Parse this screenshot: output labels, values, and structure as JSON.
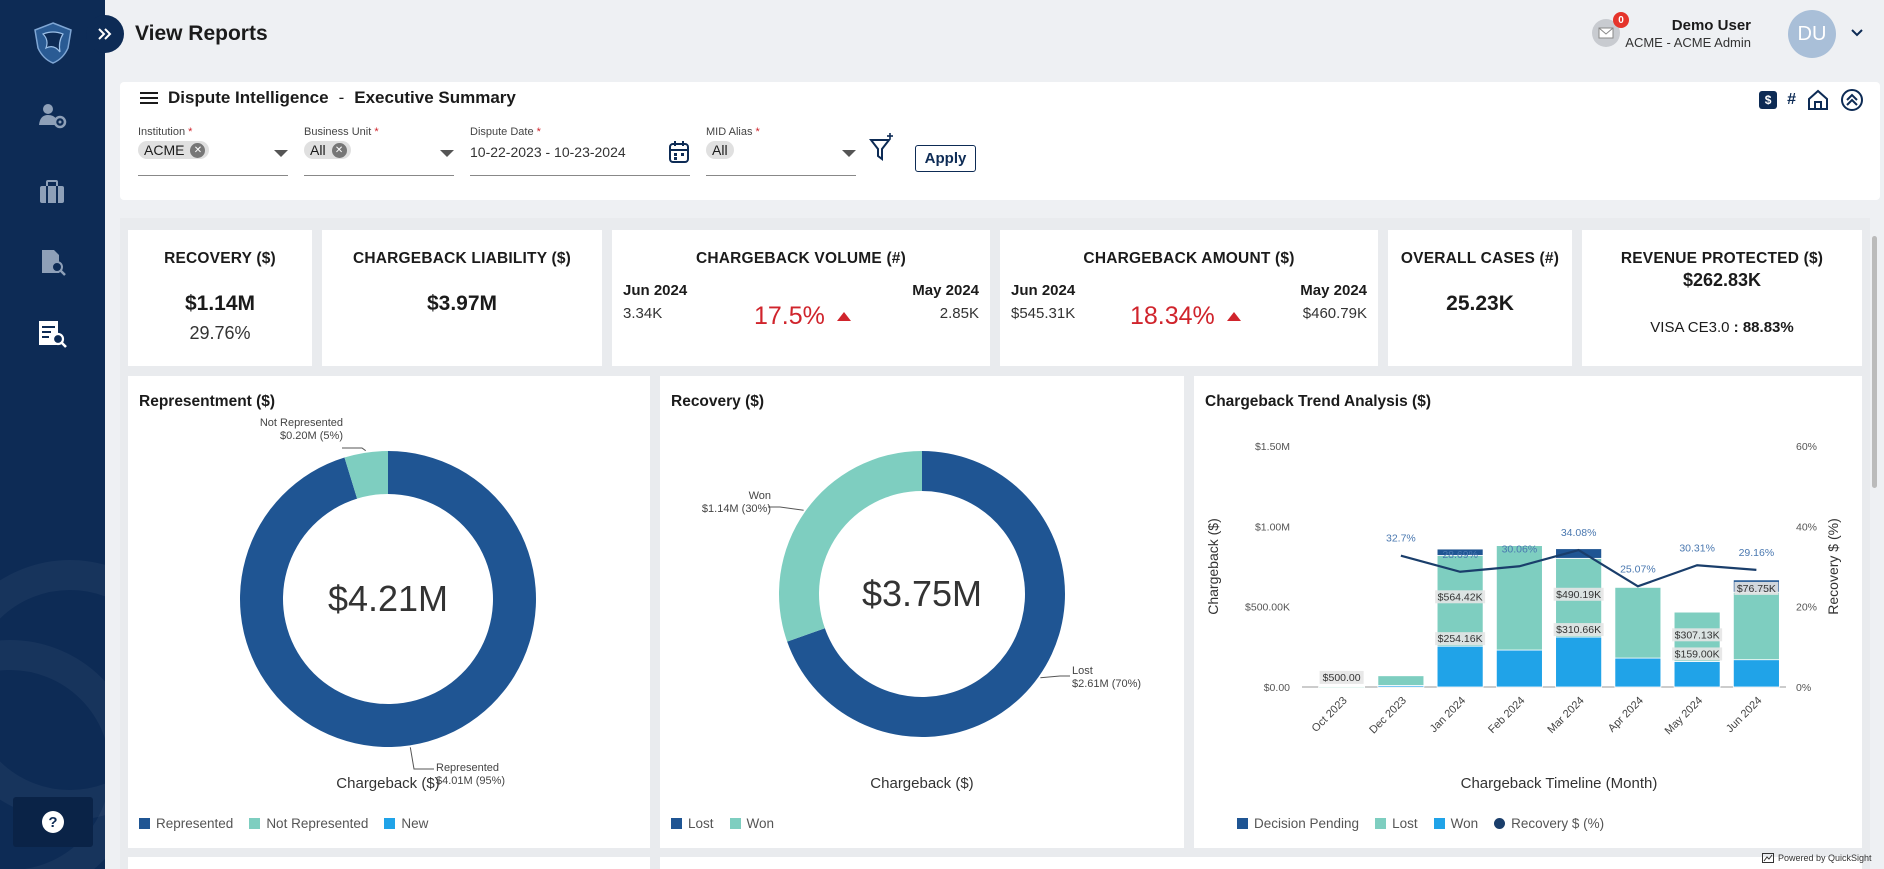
{
  "header": {
    "title": "View Reports",
    "mail_count": "0",
    "user_name": "Demo User",
    "user_role": "ACME - ACME Admin",
    "avatar_initials": "DU"
  },
  "sidebar": {
    "icons": [
      "user-settings-icon",
      "briefcase-icon",
      "document-search-icon",
      "report-search-icon"
    ],
    "help": "?"
  },
  "filters": {
    "breadcrumb_main": "Dispute Intelligence",
    "breadcrumb_sep": "-",
    "breadcrumb_sub": "Executive Summary",
    "institution_label": "Institution",
    "institution_value": "ACME",
    "business_unit_label": "Business Unit",
    "business_unit_value": "All",
    "dispute_date_label": "Dispute Date",
    "dispute_date_value": "10-22-2023 - 10-23-2024",
    "mid_alias_label": "MID Alias",
    "mid_alias_value": "All",
    "required_mark": "*",
    "apply_label": "Apply",
    "dollar_toggle": "$",
    "count_toggle": "#"
  },
  "kpis": {
    "recovery": {
      "title": "RECOVERY ($)",
      "value": "$1.14M",
      "sub": "29.76%"
    },
    "liability": {
      "title": "CHARGEBACK LIABILITY ($)",
      "value": "$3.97M"
    },
    "volume": {
      "title": "CHARGEBACK VOLUME (#)",
      "left_label": "Jun 2024",
      "left_value": "3.34K",
      "pct": "17.5%",
      "right_label": "May 2024",
      "right_value": "2.85K"
    },
    "amount": {
      "title": "CHARGEBACK AMOUNT ($)",
      "left_label": "Jun 2024",
      "left_value": "$545.31K",
      "pct": "18.34%",
      "right_label": "May 2024",
      "right_value": "$460.79K"
    },
    "cases": {
      "title": "OVERALL CASES (#)",
      "value": "25.23K"
    },
    "revenue": {
      "title": "REVENUE PROTECTED ($)",
      "value": "$262.83K",
      "visa_label": "VISA CE3.0",
      "visa_sep": ":",
      "visa_value": "88.83%"
    }
  },
  "colors": {
    "navy": "#0d2b55",
    "decision_pending": "#1f5593",
    "lost": "#7ecec0",
    "won": "#20a3e8",
    "trend_line": "#1a3e6b",
    "alert_red": "#d0242c"
  },
  "chart_data": [
    {
      "type": "pie",
      "title": "Representment ($)",
      "center_label": "$4.21M",
      "xlabel": "Chargeback ($)",
      "slices": [
        {
          "name": "Represented",
          "value": 4.01,
          "percent": 95,
          "label_line1": "Represented",
          "label_line2": "$4.01M (95%)"
        },
        {
          "name": "Not Represented",
          "value": 0.2,
          "percent": 5,
          "label_line1": "Not Represented",
          "label_line2": "$0.20M (5%)"
        }
      ],
      "legend": [
        "Represented",
        "Not Represented",
        "New"
      ]
    },
    {
      "type": "pie",
      "title": "Recovery ($)",
      "center_label": "$3.75M",
      "xlabel": "Chargeback ($)",
      "slices": [
        {
          "name": "Lost",
          "value": 2.61,
          "percent": 70,
          "label_line1": "Lost",
          "label_line2": "$2.61M (70%)"
        },
        {
          "name": "Won",
          "value": 1.14,
          "percent": 30,
          "label_line1": "Won",
          "label_line2": "$1.14M (30%)"
        }
      ],
      "legend": [
        "Lost",
        "Won"
      ]
    },
    {
      "type": "bar",
      "title": "Chargeback Trend Analysis ($)",
      "xlabel": "Chargeback Timeline (Month)",
      "ylabel": "Chargeback ($)",
      "y2label": "Recovery $ (%)",
      "categories": [
        "Oct 2023",
        "Dec 2023",
        "Jan 2024",
        "Feb 2024",
        "Mar 2024",
        "Apr 2024",
        "May 2024",
        "Jun 2024"
      ],
      "ylim": [
        0,
        1500000
      ],
      "y_ticks": [
        "$0.00",
        "$500.00K",
        "$1.00M",
        "$1.50M"
      ],
      "y2lim": [
        0,
        60
      ],
      "y2_ticks": [
        "0%",
        "20%",
        "40%",
        "60%"
      ],
      "series": [
        {
          "name": "Won",
          "values": [
            0,
            10000,
            254160,
            230000,
            310660,
            180000,
            159000,
            170000
          ]
        },
        {
          "name": "Lost",
          "values": [
            500,
            60000,
            564420,
            650000,
            490190,
            440000,
            307130,
            420000
          ]
        },
        {
          "name": "Decision Pending",
          "values": [
            0,
            0,
            40000,
            0,
            60000,
            0,
            0,
            76750
          ]
        }
      ],
      "bar_labels": [
        {
          "category": "Oct 2023",
          "text": "$500.00"
        },
        {
          "category": "Jan 2024",
          "text": "$564.42K"
        },
        {
          "category": "Jan 2024",
          "text": "$254.16K"
        },
        {
          "category": "Mar 2024",
          "text": "$490.19K"
        },
        {
          "category": "Mar 2024",
          "text": "$310.66K"
        },
        {
          "category": "May 2024",
          "text": "$307.13K"
        },
        {
          "category": "May 2024",
          "text": "$159.00K"
        },
        {
          "category": "Jun 2024",
          "text": "$76.75K"
        }
      ],
      "line": {
        "name": "Recovery $ (%)",
        "categories": [
          "Dec 2023",
          "Jan 2024",
          "Feb 2024",
          "Mar 2024",
          "Apr 2024",
          "May 2024",
          "Jun 2024"
        ],
        "values": [
          32.7,
          28.69,
          30.06,
          34.08,
          25.07,
          30.31,
          29.16
        ],
        "labels": [
          "32.7%",
          "28.69%",
          "30.06%",
          "34.08%",
          "25.07%",
          "30.31%",
          "29.16%"
        ]
      },
      "legend": [
        "Decision Pending",
        "Lost",
        "Won",
        "Recovery $ (%)"
      ]
    }
  ],
  "footer": {
    "powered_by": "Powered by QuickSight"
  }
}
